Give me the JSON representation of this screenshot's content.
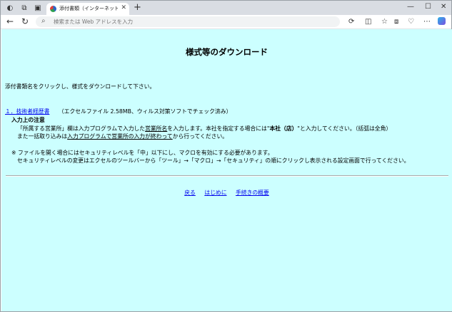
{
  "browser": {
    "tab_title": "添付書類（インターネット一元受付）",
    "new_tab": "+",
    "address_placeholder": "検索または Web アドレスを入力"
  },
  "page": {
    "title": "様式等のダウンロード",
    "intro": "添付書類名をクリックし、様式をダウンロードして下さい。",
    "item": {
      "number": "１．",
      "link_label": "技術者経歴書",
      "file_info": "（エクセルファイル 2.58MB、ウィルス対策ソフトでチェック済み）",
      "notes_heading": "入力上の注意",
      "note1_a": "「所属する営業所」欄は入力プログラムで入力した",
      "note1_b": "営業所名",
      "note1_c": "を入力します。本社を指定する場合には\"",
      "note1_d": "本社（店）",
      "note1_e": "\"と入力してください。（括弧は全角）",
      "note2_a": "また一括取り込みは",
      "note2_b": "入力プログラムで営業所の入力が終わって",
      "note2_c": "から行ってください。"
    },
    "security_note_1": "※ ファイルを開く場合にはセキュリティレベルを「中」以下にし、マクロを有効にする必要があります。",
    "security_note_2": "セキュリティレベルの変更はエクセルのツールバーから「ツール」→「マクロ」→「セキュリティ」の順にクリックし表示される設定画面で行ってください。",
    "footer_links": {
      "back": "戻る",
      "start": "はじめに",
      "overview": "手続きの概要"
    }
  }
}
